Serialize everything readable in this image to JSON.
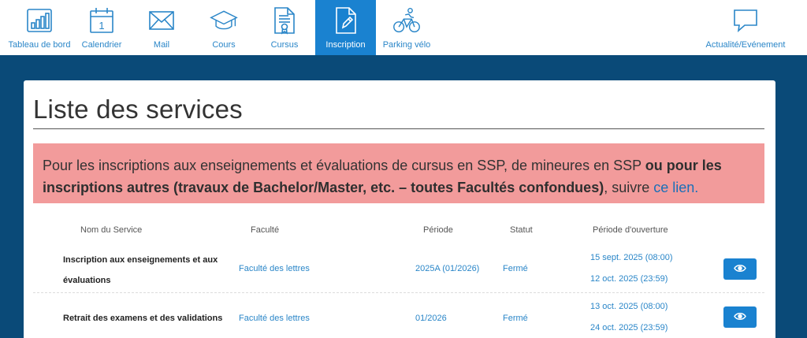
{
  "nav": {
    "items": [
      {
        "label": "Tableau de bord",
        "icon": "dashboard-icon"
      },
      {
        "label": "Calendrier",
        "icon": "calendar-icon"
      },
      {
        "label": "Mail",
        "icon": "mail-icon"
      },
      {
        "label": "Cours",
        "icon": "graduation-cap-icon"
      },
      {
        "label": "Cursus",
        "icon": "certificate-document-icon"
      },
      {
        "label": "Inscription",
        "icon": "edit-document-icon"
      },
      {
        "label": "Parking vélo",
        "icon": "bicycle-icon"
      },
      {
        "label": "Actualité/Evénement",
        "icon": "chat-bubble-icon"
      }
    ],
    "active": "Inscription",
    "calendar_day": "1"
  },
  "page": {
    "title": "Liste des services"
  },
  "alert": {
    "text_start": "Pour les inscriptions aux enseignements et évaluations de cursus en SSP, de mineures en SSP ",
    "text_bold": "ou pour les inscriptions autres (travaux de Bachelor/Master, etc. – toutes Facultés confondues)",
    "text_end": ", suivre ",
    "link": "ce lien."
  },
  "table": {
    "headers": [
      "Nom du Service",
      "Faculté",
      "Période",
      "Statut",
      "Période d'ouverture"
    ],
    "rows": [
      {
        "name_line1": "Inscription aux enseignements et aux",
        "name_line2": "évaluations",
        "faculty": "Faculté des lettres",
        "period": "2025A (01/2026)",
        "status": "Fermé",
        "open_start": "15 sept. 2025 (08:00)",
        "open_end": "12 oct. 2025 (23:59)",
        "action_icon": "eye-icon"
      },
      {
        "name_line1": "Retrait des examens et des validations",
        "faculty": "Faculté des lettres",
        "period": "01/2026",
        "status": "Fermé",
        "open_start": "13 oct. 2025 (08:00)",
        "open_end": "24 oct. 2025 (23:59)",
        "action_icon": "eye-icon"
      }
    ]
  },
  "colors": {
    "primary": "#1a82d0",
    "background": "#0a4a78",
    "alert": "#f29b9b",
    "link": "#2a86c8"
  }
}
